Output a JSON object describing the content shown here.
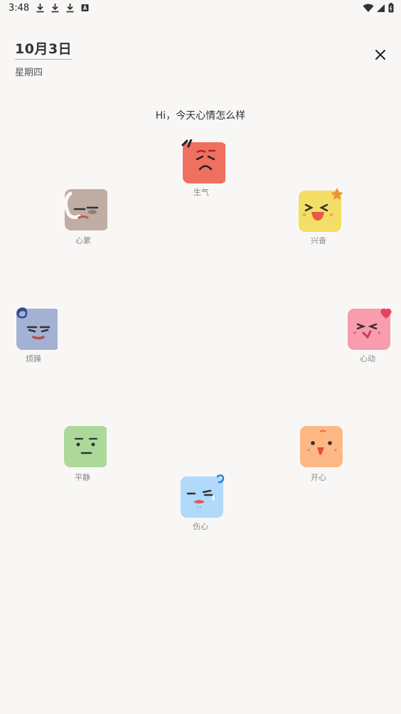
{
  "status_bar": {
    "time": "3:48"
  },
  "header": {
    "date": "10月3日",
    "weekday": "星期四"
  },
  "greeting": "Hi，今天心情怎么样",
  "moods": [
    {
      "key": "angry",
      "label": "生气",
      "color": "#ef7060"
    },
    {
      "key": "tired",
      "label": "心累",
      "color": "#bfada3"
    },
    {
      "key": "excited",
      "label": "兴奋",
      "color": "#f4de65"
    },
    {
      "key": "irritable",
      "label": "烦躁",
      "color": "#a3b1d3"
    },
    {
      "key": "heart-flutter",
      "label": "心动",
      "color": "#f79dad"
    },
    {
      "key": "calm",
      "label": "平静",
      "color": "#acd99a"
    },
    {
      "key": "happy",
      "label": "开心",
      "color": "#fdb886"
    },
    {
      "key": "sad",
      "label": "伤心",
      "color": "#b0d9fa"
    }
  ]
}
